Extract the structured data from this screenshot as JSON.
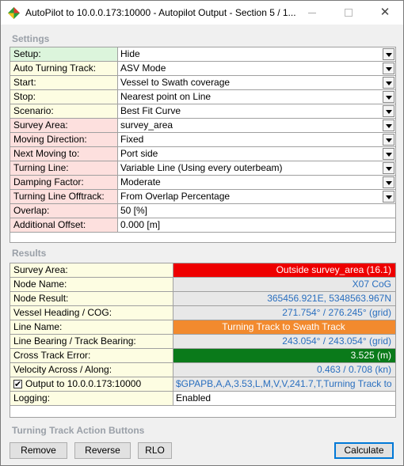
{
  "window": {
    "title": "AutoPilot to 10.0.0.173:10000 - Autopilot Output - Section 5 / 1..."
  },
  "settings": {
    "label": "Settings",
    "rows": [
      {
        "label": "Setup:",
        "value": "Hide",
        "dropdown": true,
        "color": "green"
      },
      {
        "label": "Auto Turning Track:",
        "value": "ASV Mode",
        "dropdown": true,
        "color": "yellow"
      },
      {
        "label": "Start:",
        "value": "Vessel to Swath coverage",
        "dropdown": true,
        "color": "yellow"
      },
      {
        "label": "Stop:",
        "value": "Nearest point on Line",
        "dropdown": true,
        "color": "yellow"
      },
      {
        "label": "Scenario:",
        "value": "Best Fit Curve",
        "dropdown": true,
        "color": "yellow"
      },
      {
        "label": "Survey Area:",
        "value": "survey_area",
        "dropdown": true,
        "color": "pink"
      },
      {
        "label": "Moving Direction:",
        "value": "Fixed",
        "dropdown": true,
        "color": "pink"
      },
      {
        "label": "Next Moving to:",
        "value": "Port side",
        "dropdown": true,
        "color": "pink"
      },
      {
        "label": "Turning Line:",
        "value": "Variable Line (Using every outerbeam)",
        "dropdown": true,
        "color": "pink"
      },
      {
        "label": "Damping Factor:",
        "value": "Moderate",
        "dropdown": true,
        "color": "pink"
      },
      {
        "label": "Turning Line Offtrack:",
        "value": "From Overlap Percentage",
        "dropdown": true,
        "color": "pink"
      },
      {
        "label": "Overlap:",
        "value": "50 [%]",
        "dropdown": false,
        "color": "pink"
      },
      {
        "label": "Additional Offset:",
        "value": "0.000 [m]",
        "dropdown": false,
        "color": "pink"
      }
    ]
  },
  "results": {
    "label": "Results",
    "rows": [
      {
        "label": "Survey Area:",
        "value": "Outside survey_area (16.1)",
        "style": "red"
      },
      {
        "label": "Node Name:",
        "value": "X07 CoG",
        "style": "grey"
      },
      {
        "label": "Node Result:",
        "value": "365456.921E, 5348563.967N",
        "style": "grey"
      },
      {
        "label": "Vessel Heading / COG:",
        "value": "271.754° / 276.245° (grid)",
        "style": "grey"
      },
      {
        "label": "Line Name:",
        "value": "Turning Track to Swath Track",
        "style": "orange"
      },
      {
        "label": "Line Bearing / Track Bearing:",
        "value": "243.054° / 243.054° (grid)",
        "style": "grey"
      },
      {
        "label": "Cross Track Error:",
        "value": "3.525 (m)",
        "style": "green"
      },
      {
        "label": "Velocity Across / Along:",
        "value": "0.463 / 0.708 (kn)",
        "style": "grey"
      },
      {
        "label": "Output to 10.0.0.173:10000",
        "value": "$GPAPB,A,A,3.53,L,M,V,V,241.7,T,Turning Track to ...",
        "style": "grey",
        "checkbox": true
      },
      {
        "label": "Logging:",
        "value": "Enabled",
        "style": "plain"
      }
    ]
  },
  "actions": {
    "label": "Turning Track Action Buttons",
    "remove": "Remove",
    "reverse": "Reverse",
    "rlo": "RLO",
    "calculate": "Calculate"
  }
}
